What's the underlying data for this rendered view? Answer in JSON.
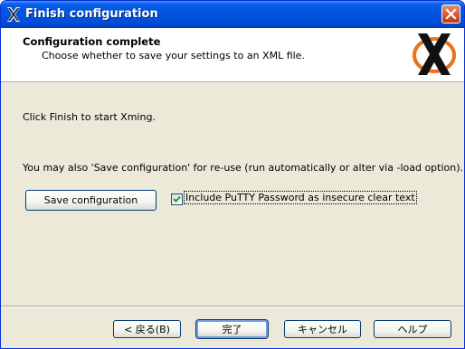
{
  "window": {
    "title": "Finish configuration"
  },
  "header": {
    "title": "Configuration complete",
    "subtitle": "Choose whether to save your settings to an XML file.",
    "logo": "xming-logo"
  },
  "body": {
    "finish_text": "Click Finish to start Xming.",
    "save_text": "You may also 'Save configuration' for re-use (run automatically or alter via -load option).",
    "save_button": "Save configuration",
    "include_putty_label": "Include PuTTY Password as insecure clear text",
    "include_putty_checked": true
  },
  "footer": {
    "back_button": "< 戻る(B)",
    "finish_button": "完了",
    "cancel_button": "キャンセル",
    "help_button": "ヘルプ"
  },
  "colors": {
    "titlebar": "#0054e3",
    "dialog_bg": "#ece9d8",
    "close_button": "#d8593a",
    "logo_orange": "#e8731c",
    "check_green": "#21a121"
  }
}
